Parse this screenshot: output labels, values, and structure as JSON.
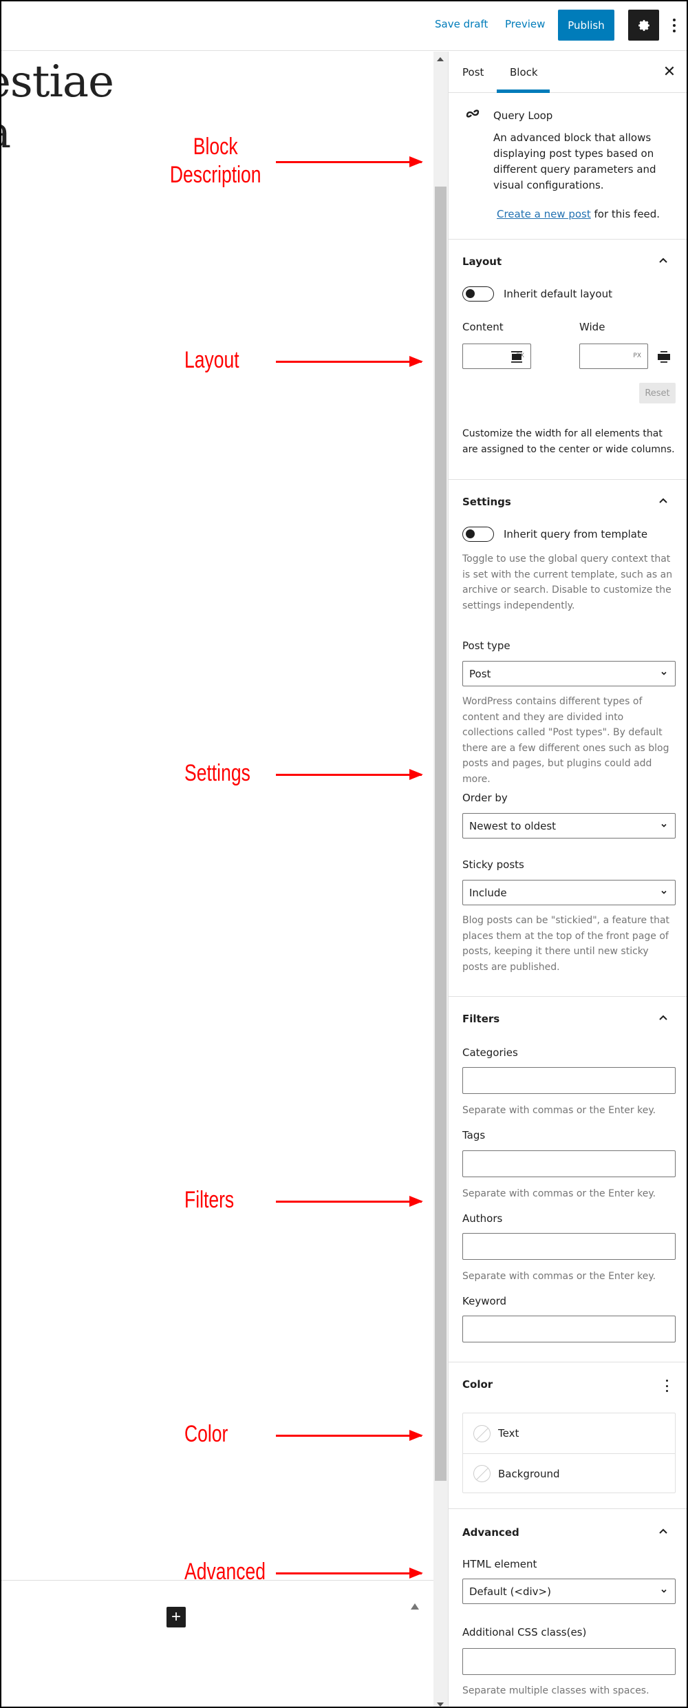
{
  "header": {
    "save_draft": "Save draft",
    "preview": "Preview",
    "publish": "Publish",
    "settings_icon": "gear-icon",
    "options_icon": "more-vertical-icon",
    "accent_color": "#007cba"
  },
  "canvas": {
    "title_line1": "estiae",
    "title_line2": "a",
    "add_block_label": "+"
  },
  "annotations": [
    {
      "label": "Block Description",
      "target": "block-card"
    },
    {
      "label": "Layout",
      "target": "layout-panel"
    },
    {
      "label": "Settings",
      "target": "settings-panel"
    },
    {
      "label": "Filters",
      "target": "filters-panel"
    },
    {
      "label": "Color",
      "target": "color-panel"
    },
    {
      "label": "Advanced",
      "target": "advanced-panel"
    }
  ],
  "annotation_line1": "Block",
  "annotation_line2": "Description",
  "annotation_color": "#ff0000",
  "sidebar": {
    "tabs": [
      {
        "label": "Post",
        "active": false
      },
      {
        "label": "Block",
        "active": true
      }
    ],
    "close_label": "✕",
    "block": {
      "icon": "loop-icon",
      "title": "Query Loop",
      "description": "An advanced block that allows displaying post types based on different query parameters and visual configurations.",
      "link_text": "Create a new post",
      "link_suffix": " for this feed."
    },
    "layout": {
      "title": "Layout",
      "toggle_label": "Inherit default layout",
      "toggle_on": false,
      "content_label": "Content",
      "wide_label": "Wide",
      "content_value": "",
      "wide_value": "",
      "unit": "PX",
      "reset_label": "Reset",
      "help": "Customize the width for all elements that are assigned to the center or wide columns."
    },
    "settings": {
      "title": "Settings",
      "toggle_label": "Inherit query from template",
      "toggle_on": false,
      "toggle_help": "Toggle to use the global query context that is set with the current template, such as an archive or search. Disable to customize the settings independently.",
      "post_type_label": "Post type",
      "post_type_value": "Post",
      "post_type_help": "WordPress contains different types of content and they are divided into collections called \"Post types\". By default there are a few different ones such as blog posts and pages, but plugins could add more.",
      "order_by_label": "Order by",
      "order_by_value": "Newest to oldest",
      "sticky_label": "Sticky posts",
      "sticky_value": "Include",
      "sticky_help": "Blog posts can be \"stickied\", a feature that places them at the top of the front page of posts, keeping it there until new sticky posts are published."
    },
    "filters": {
      "title": "Filters",
      "categories_label": "Categories",
      "categories_value": "",
      "tags_label": "Tags",
      "tags_value": "",
      "authors_label": "Authors",
      "authors_value": "",
      "keyword_label": "Keyword",
      "keyword_value": "",
      "separator_help": "Separate with commas or the Enter key."
    },
    "color": {
      "title": "Color",
      "items": [
        {
          "label": "Text"
        },
        {
          "label": "Background"
        }
      ]
    },
    "advanced": {
      "title": "Advanced",
      "html_element_label": "HTML element",
      "html_element_value": "Default (<div>)",
      "css_class_label": "Additional CSS class(es)",
      "css_class_value": "",
      "css_class_help": "Separate multiple classes with spaces."
    }
  }
}
